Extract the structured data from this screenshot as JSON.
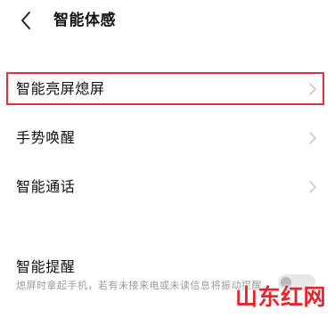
{
  "header": {
    "title": "智能体感",
    "back_icon": "chevron-left-icon"
  },
  "settings": [
    {
      "label": "智能亮屏熄屏",
      "highlighted": true
    },
    {
      "label": "手势唤醒"
    },
    {
      "label": "智能通话"
    }
  ],
  "smart_reminder": {
    "title": "智能提醒",
    "description": "熄屏时拿起手机，若有未接来电或未读信息将振动提醒。",
    "enabled": false
  },
  "watermark": {
    "text": "山东红网"
  },
  "colors": {
    "highlight_border": "#e4303b",
    "watermark": "#e3262d",
    "chevron": "#bdbdbd",
    "toggle_off_track": "#e6e6e6",
    "secondary_text": "#9a9a9a"
  }
}
